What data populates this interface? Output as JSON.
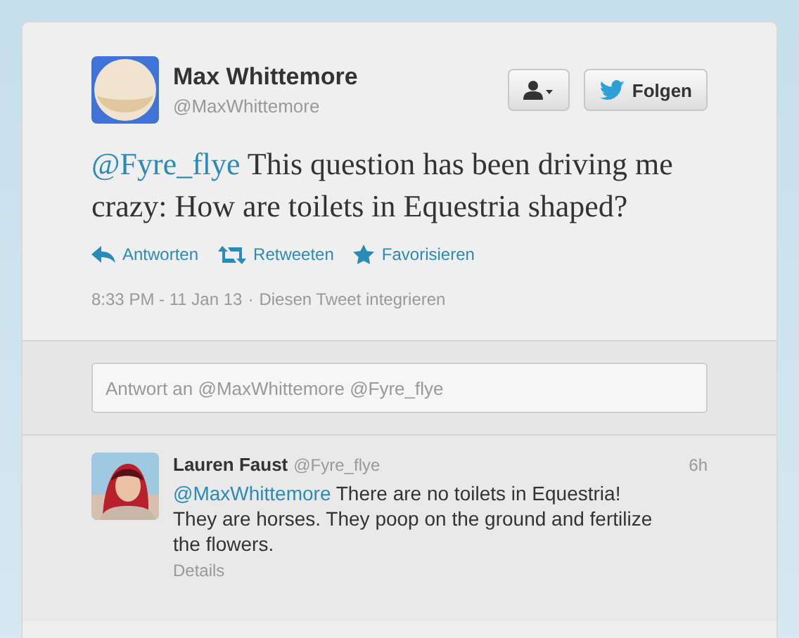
{
  "tweet": {
    "author": {
      "name": "Max Whittemore",
      "handle": "@MaxWhittemore"
    },
    "follow_button": {
      "label": "Folgen"
    },
    "mention": "@Fyre_flye",
    "text": "This question has been driving me crazy: How are toilets in Equestria shaped?",
    "actions": [
      {
        "kind": "reply",
        "label": "Antworten"
      },
      {
        "kind": "retweet",
        "label": "Retweeten"
      },
      {
        "kind": "favorite",
        "label": "Favorisieren"
      }
    ],
    "meta": {
      "time": "8:33 PM - 11 Jan 13",
      "separator": "·",
      "embed_link": "Diesen Tweet integrieren"
    }
  },
  "reply_box": {
    "placeholder": "Antwort an @MaxWhittemore @Fyre_flye"
  },
  "replies": [
    {
      "name": "Lauren Faust",
      "handle": "@Fyre_flye",
      "time": "6h",
      "mention": "@MaxWhittemore",
      "text": "There are no toilets in Equestria! They are horses. They poop on the ground and fertilize the flowers.",
      "details": "Details"
    }
  ]
}
